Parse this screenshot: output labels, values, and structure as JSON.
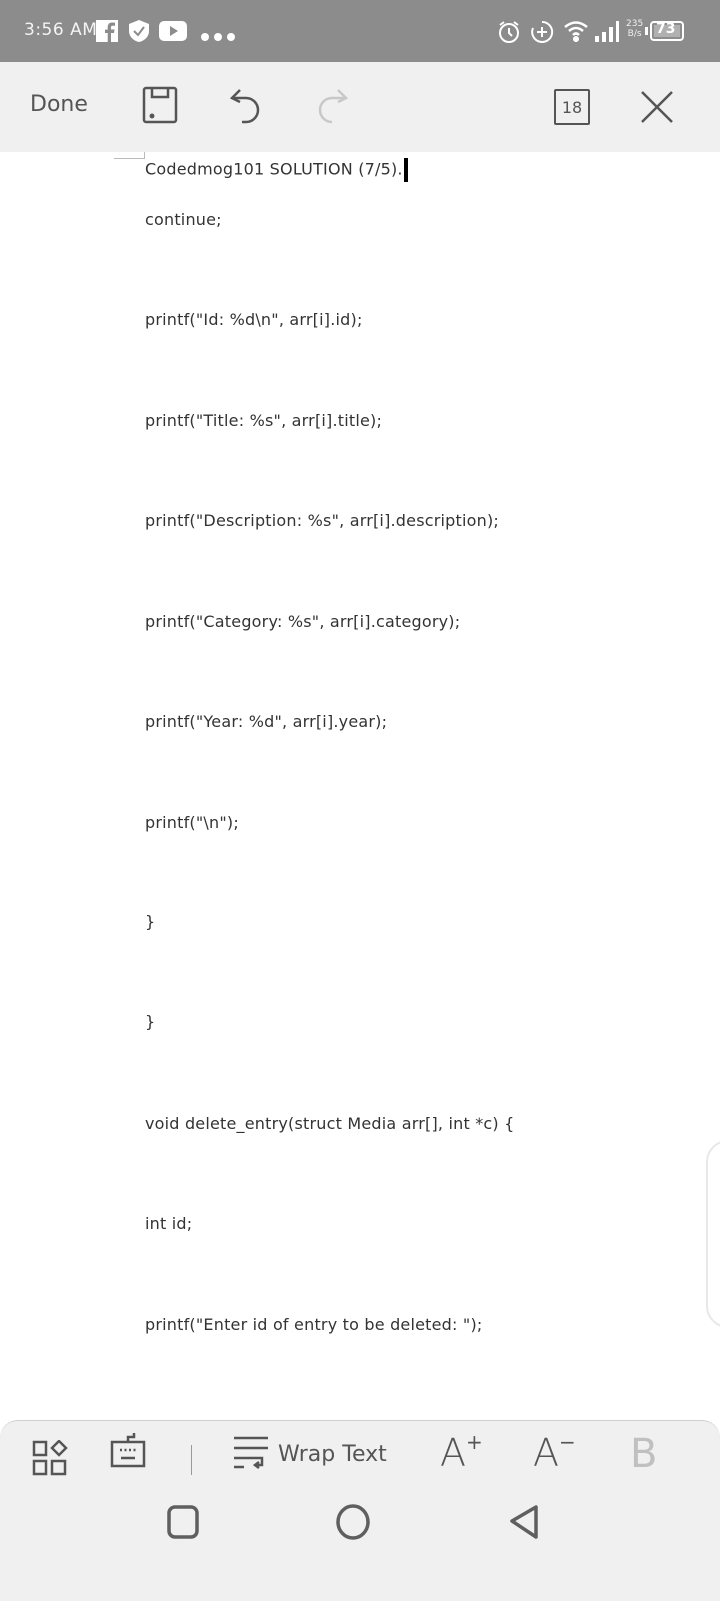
{
  "status_bar": {
    "time": "3:56 AM",
    "notification_icons": [
      "facebook-icon",
      "shield-check-icon",
      "youtube-icon",
      "more-dots-icon"
    ],
    "system_icons": [
      "alarm-icon",
      "data-saver-icon",
      "wifi-icon",
      "signal-icon"
    ],
    "net_speed_value": "235",
    "net_speed_unit": "B/s",
    "battery": "73"
  },
  "toolbar": {
    "done_label": "Done",
    "save_icon": "save-icon",
    "undo_icon": "undo-icon",
    "redo_icon": "redo-icon",
    "font_size_value": "18",
    "close_icon": "close-icon"
  },
  "document": {
    "lines": [
      "Codedmog101 SOLUTION (7/5).",
      "continue;",
      "printf(\"Id: %d\\n\", arr[i].id);",
      "printf(\"Title: %s\", arr[i].title);",
      "printf(\"Description: %s\", arr[i].description);",
      "printf(\"Category: %s\", arr[i].category);",
      "printf(\"Year: %d\", arr[i].year);",
      "printf(\"\\n\");",
      "}",
      "}",
      "void delete_entry(struct Media arr[], int *c) {",
      "int id;",
      "printf(\"Enter id of entry to be deleted: \");"
    ]
  },
  "bottom_toolbar": {
    "wrap_text_label": "Wrap Text",
    "font_increase_label": "A",
    "font_decrease_label": "A",
    "bold_label": "B"
  },
  "nav_bar": {
    "recents": "recents-icon",
    "home": "home-icon",
    "back": "back-icon"
  }
}
